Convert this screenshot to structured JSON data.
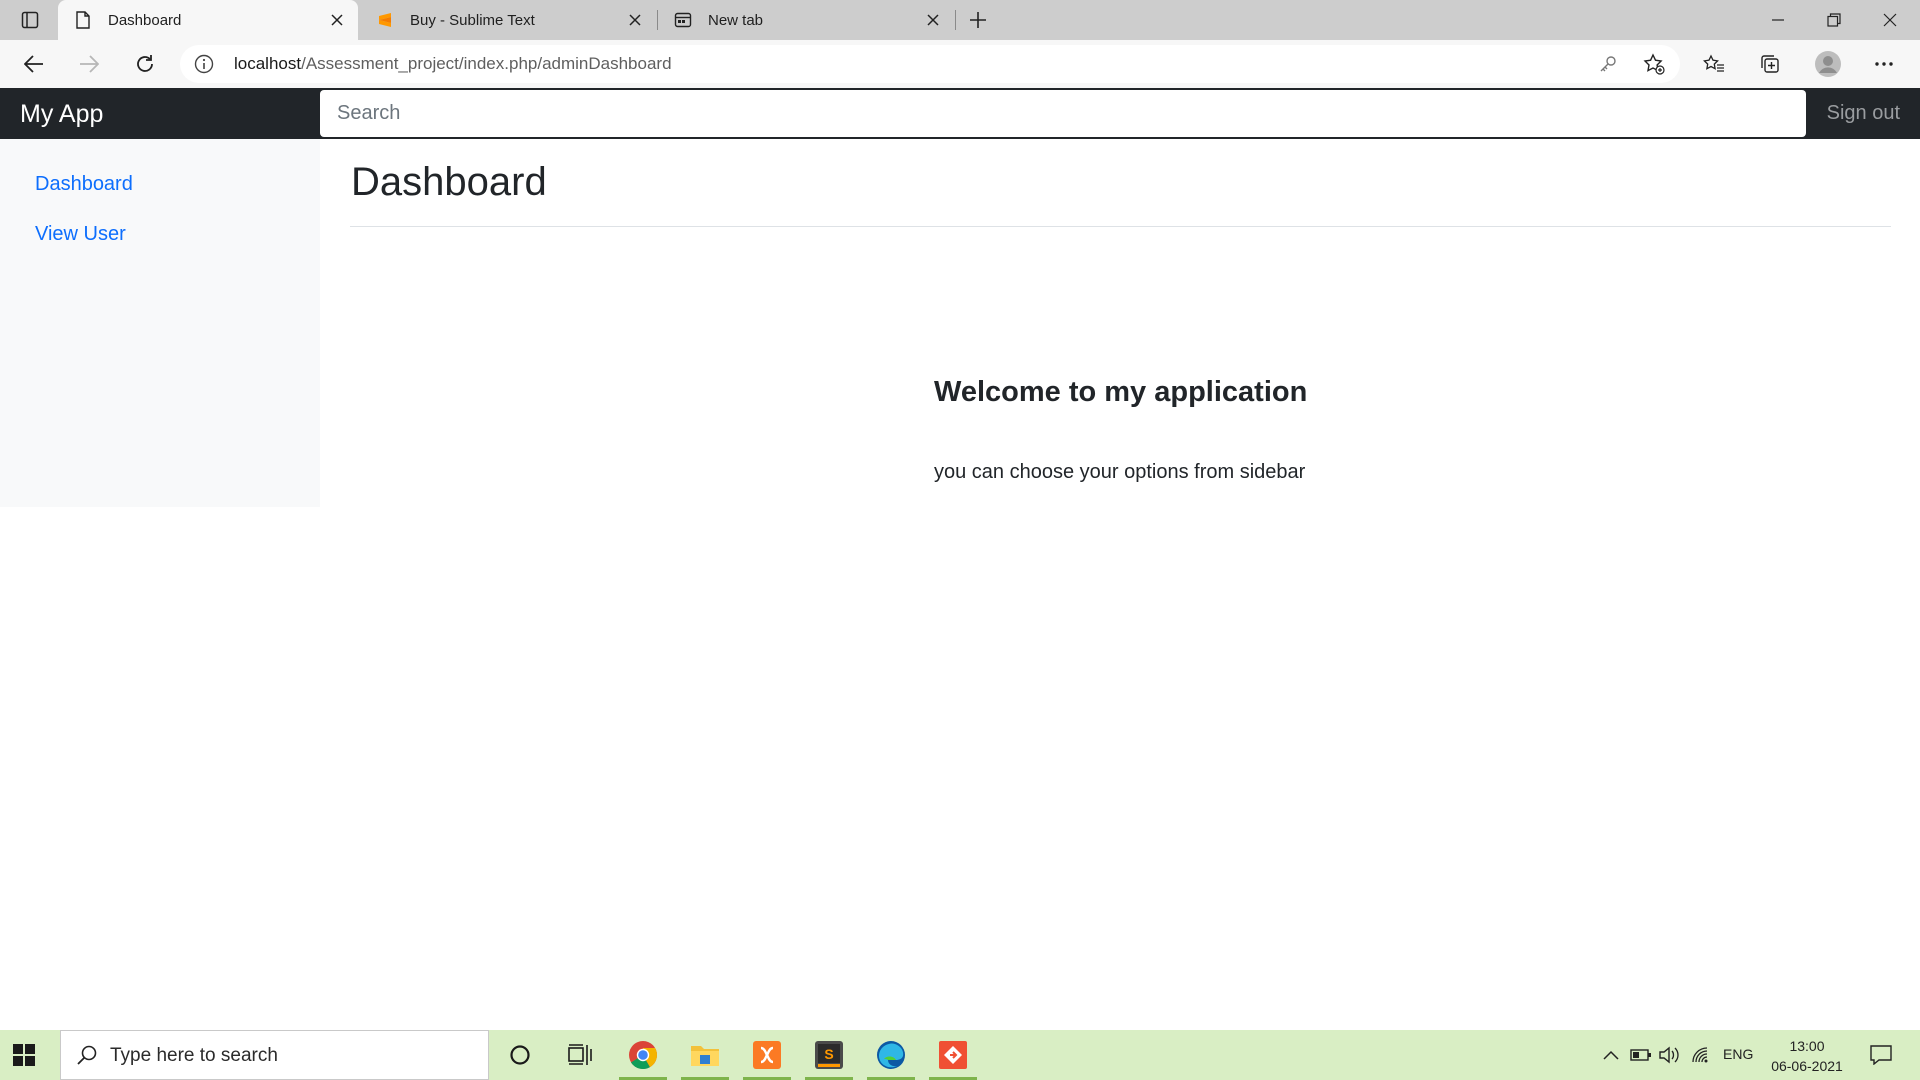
{
  "browser": {
    "tabs": [
      {
        "title": "Dashboard",
        "favicon": "page-icon",
        "active": true
      },
      {
        "title": "Buy - Sublime Text",
        "favicon": "sublime-icon",
        "active": false
      },
      {
        "title": "New tab",
        "favicon": "new-tab-page-icon",
        "active": false
      }
    ],
    "url": {
      "host": "localhost",
      "path": "/Assessment_project/index.php/adminDashboard"
    },
    "window_controls": [
      "minimize-icon",
      "restore-icon",
      "close-icon"
    ],
    "toolbar_icons": [
      "favorites-icon",
      "collections-icon",
      "profile-icon",
      "more-icon"
    ]
  },
  "app": {
    "brand": "My App",
    "search_placeholder": "Search",
    "signout_label": "Sign out",
    "sidebar": [
      {
        "label": "Dashboard"
      },
      {
        "label": "View User"
      }
    ],
    "page_title": "Dashboard",
    "welcome_heading": "Welcome to my application",
    "welcome_text": "you can choose your options from sidebar",
    "colors": {
      "navbar": "#212529",
      "link": "#0d6efd",
      "sidebar_bg": "#f8f9fa"
    }
  },
  "taskbar": {
    "search_placeholder": "Type here to search",
    "pinned_apps": [
      "cortana-icon",
      "task-view-icon",
      "chrome-icon",
      "file-explorer-icon",
      "xampp-icon",
      "sublime-text-icon",
      "edge-icon",
      "git-icon"
    ],
    "tray": {
      "language": "ENG",
      "time": "13:00",
      "date": "06-06-2021"
    }
  }
}
